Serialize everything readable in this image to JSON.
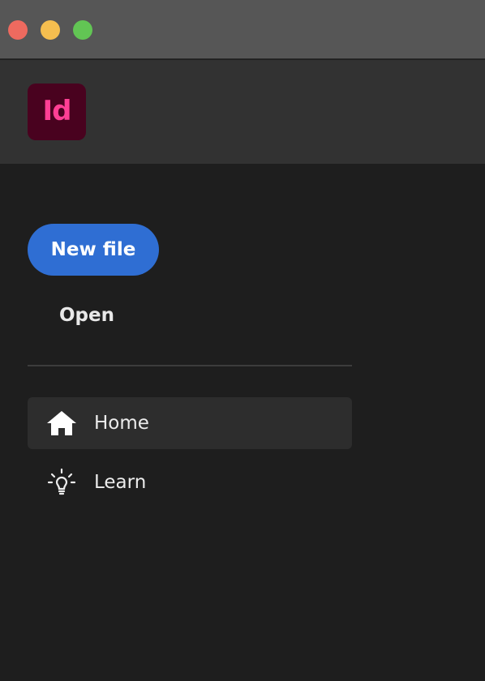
{
  "window": {
    "controls": [
      "close",
      "minimize",
      "maximize"
    ],
    "colors": {
      "close": "#ee6a5f",
      "minimize": "#f5be4f",
      "maximize": "#62c554"
    }
  },
  "app": {
    "logo_text": "Id",
    "logo_bg": "#49021f",
    "logo_fg": "#ff3f94"
  },
  "sidebar": {
    "new_file_label": "New file",
    "open_label": "Open",
    "nav": [
      {
        "label": "Home",
        "icon": "home-icon",
        "active": true
      },
      {
        "label": "Learn",
        "icon": "lightbulb-icon",
        "active": false
      }
    ]
  },
  "colors": {
    "accent": "#2f6ed3",
    "background": "#1e1e1e",
    "header": "#323232",
    "titlebar": "#565656"
  }
}
